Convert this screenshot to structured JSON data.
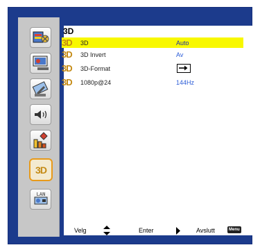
{
  "sidebar": {
    "items": [
      {
        "icon": "picture-settings-icon"
      },
      {
        "icon": "screen-settings-icon"
      },
      {
        "icon": "setup-wrench-icon"
      },
      {
        "icon": "volume-icon"
      },
      {
        "icon": "options-icon"
      },
      {
        "icon": "3d-icon",
        "label": "3D",
        "active": true
      },
      {
        "icon": "network-projector-icon",
        "label": "LAN"
      }
    ]
  },
  "menu": {
    "title": "3D",
    "rows": [
      {
        "icon": "3D",
        "label": "3D",
        "value": "Auto",
        "selected": true
      },
      {
        "icon": "3D",
        "label": "3D Invert",
        "value": "Av"
      },
      {
        "icon": "3D",
        "label": "3D-Format",
        "value_icon": "side-by-side-format-icon"
      },
      {
        "icon": "3D",
        "label": "1080p@24",
        "value": "144Hz"
      }
    ]
  },
  "footer": {
    "select_label": "Velg",
    "enter_label": "Enter",
    "exit_label": "Avslutt",
    "menu_key": "Menu"
  },
  "colors": {
    "frame": "#1c3b8c",
    "sidebar": "#c7c7c7",
    "highlight": "#f8f800",
    "accent": "#e89a1a",
    "value_blue": "#2a5bd7"
  }
}
